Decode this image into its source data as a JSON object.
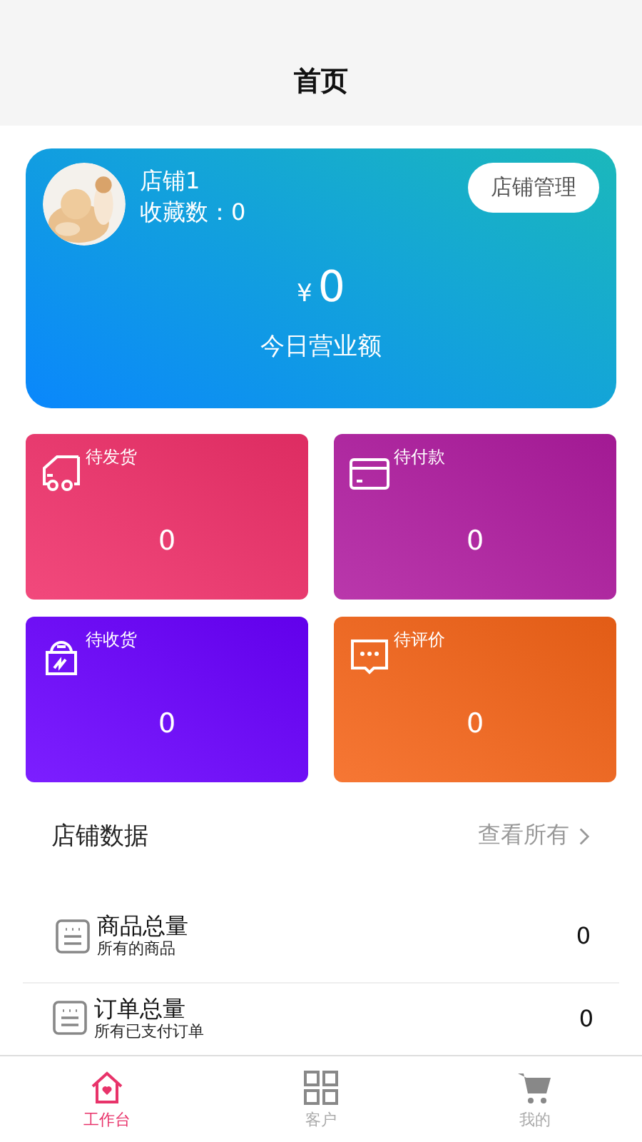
{
  "header": {
    "title": "首页"
  },
  "store_card": {
    "name": "店铺1",
    "favorites": "收藏数：0",
    "manage_button": "店铺管理",
    "currency": "¥",
    "revenue": "0",
    "revenue_label": "今日营业额"
  },
  "order_tiles": [
    {
      "kind": "truck",
      "label": "待发货",
      "count": "0",
      "color": "#f0306a"
    },
    {
      "kind": "card",
      "label": "待付款",
      "count": "0",
      "color": "#b01ca0"
    },
    {
      "kind": "bag",
      "label": "待收货",
      "count": "0",
      "color": "#6a00ff"
    },
    {
      "kind": "chat",
      "label": "待评价",
      "count": "0",
      "color": "#f56418"
    }
  ],
  "store_data": {
    "title": "店铺数据",
    "view_all": "查看所有",
    "rows": [
      {
        "title": "商品总量",
        "subtitle": "所有的商品",
        "value": "0"
      },
      {
        "title": "订单总量",
        "subtitle": "所有已支付订单",
        "value": "0"
      }
    ]
  },
  "tab_bar": [
    {
      "kind": "home",
      "label": "工作台",
      "selected": true
    },
    {
      "kind": "grid",
      "label": "客户",
      "selected": false
    },
    {
      "kind": "cart",
      "label": "我的",
      "selected": false
    }
  ]
}
